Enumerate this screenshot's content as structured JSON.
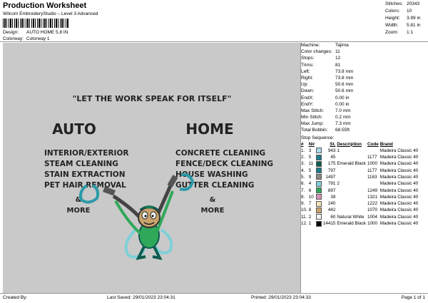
{
  "header": {
    "title": "Production Worksheet",
    "subtitle": "Wilcom EmbroideryStudio – Level 3 Advanced",
    "design_label": "Design:",
    "design_value": "AUTO HOME 5,8 IN",
    "colorway_label": "Colorway:",
    "colorway_value": "Colorway 1"
  },
  "stats": [
    {
      "label": "Stitches:",
      "value": "20343"
    },
    {
      "label": "Colors:",
      "value": "10"
    },
    {
      "label": "Height:",
      "value": "3.99 in"
    },
    {
      "label": "Width:",
      "value": "5.81 in"
    },
    {
      "label": "Zoom:",
      "value": "1:1"
    }
  ],
  "design_text": {
    "slogan": "\"LET THE WORK SPEAK FOR ITSELF\"",
    "left_heading": "AUTO",
    "right_heading": "HOME",
    "left_items": [
      "INTERIOR/EXTERIOR",
      "STEAM CLEANING",
      "STAIN EXTRACTION",
      "PET HAIR REMOVAL"
    ],
    "right_items": [
      "CONCRETE CLEANING",
      "FENCE/DECK CLEANING",
      "HOUSE WASHING",
      "GUTTER CLEANING"
    ],
    "amp": "&",
    "more": "MORE"
  },
  "machine": [
    {
      "label": "Machine:",
      "value": "Tajima"
    },
    {
      "label": "Color changes:",
      "value": "11"
    },
    {
      "label": "Stops:",
      "value": "12"
    },
    {
      "label": "Trims:",
      "value": "81"
    },
    {
      "label": "Left:",
      "value": "73.8 mm"
    },
    {
      "label": "Right:",
      "value": "73.8 mm"
    },
    {
      "label": "Up:",
      "value": "50.6 mm"
    },
    {
      "label": "Down:",
      "value": "50.6 mm"
    },
    {
      "label": "EndX:",
      "value": "0.00 in"
    },
    {
      "label": "EndY:",
      "value": "0.00 in"
    },
    {
      "label": "Max Stitch:",
      "value": "7.0 mm"
    },
    {
      "label": "Min Stitch:",
      "value": "0.2 mm"
    },
    {
      "label": "Max Jump:",
      "value": "7.3 mm"
    },
    {
      "label": "Total Bobbin:",
      "value": "68.55ft"
    }
  ],
  "sequence": {
    "title": "Stop Sequence:",
    "headers": [
      "#",
      "N#",
      "",
      "St.",
      "Description",
      "Code",
      "Brand"
    ],
    "rows": [
      {
        "num": "1.",
        "n": "3",
        "color": "#a8dde6",
        "st": "943",
        "desc": "1",
        "code": "",
        "brand": "Madeira Classic 40"
      },
      {
        "num": "2.",
        "n": "5",
        "color": "#1e7d8c",
        "st": "45",
        "desc": "",
        "code": "1177",
        "brand": "Madeira Classic 40"
      },
      {
        "num": "3.",
        "n": "11",
        "color": "#0d5c4f",
        "st": "175",
        "desc": "Emerald Black",
        "code": "1000",
        "brand": "Madeira Classic 40"
      },
      {
        "num": "4.",
        "n": "5",
        "color": "#1e7d8c",
        "st": "797",
        "desc": "",
        "code": "1177",
        "brand": "Madeira Classic 40"
      },
      {
        "num": "5.",
        "n": "9",
        "color": "#8a8a8a",
        "st": "1497",
        "desc": "",
        "code": "1163",
        "brand": "Madeira Classic 40"
      },
      {
        "num": "6.",
        "n": "4",
        "color": "#7ed0d8",
        "st": "791",
        "desc": "2",
        "code": "",
        "brand": "Madeira Classic 40"
      },
      {
        "num": "7.",
        "n": "6",
        "color": "#2fa85a",
        "st": "897",
        "desc": "",
        "code": "1249",
        "brand": "Madeira Classic 40"
      },
      {
        "num": "8.",
        "n": "10",
        "color": "#d990b8",
        "st": "39",
        "desc": "",
        "code": "1321",
        "brand": "Madeira Classic 40"
      },
      {
        "num": "9.",
        "n": "7",
        "color": "#f1e3b4",
        "st": "240",
        "desc": "",
        "code": "1222",
        "brand": "Madeira Classic 40"
      },
      {
        "num": "10.",
        "n": "8",
        "color": "#c9a36c",
        "st": "442",
        "desc": "",
        "code": "1070",
        "brand": "Madeira Classic 40"
      },
      {
        "num": "11.",
        "n": "2",
        "color": "#f4f4f0",
        "st": "60",
        "desc": "Natural White",
        "code": "1004",
        "brand": "Madeira Classic 40"
      },
      {
        "num": "12.",
        "n": "1",
        "color": "#0a0a0a",
        "st": "14415",
        "desc": "Emerald Black",
        "code": "1000",
        "brand": "Madeira Classic 40"
      }
    ]
  },
  "footer": {
    "created_by": "Created By:",
    "last_saved": "Last Saved: 29/01/2023 23:04:31",
    "printed": "Printed: 29/01/2023 23:04:33",
    "page": "Page 1 of 1"
  }
}
